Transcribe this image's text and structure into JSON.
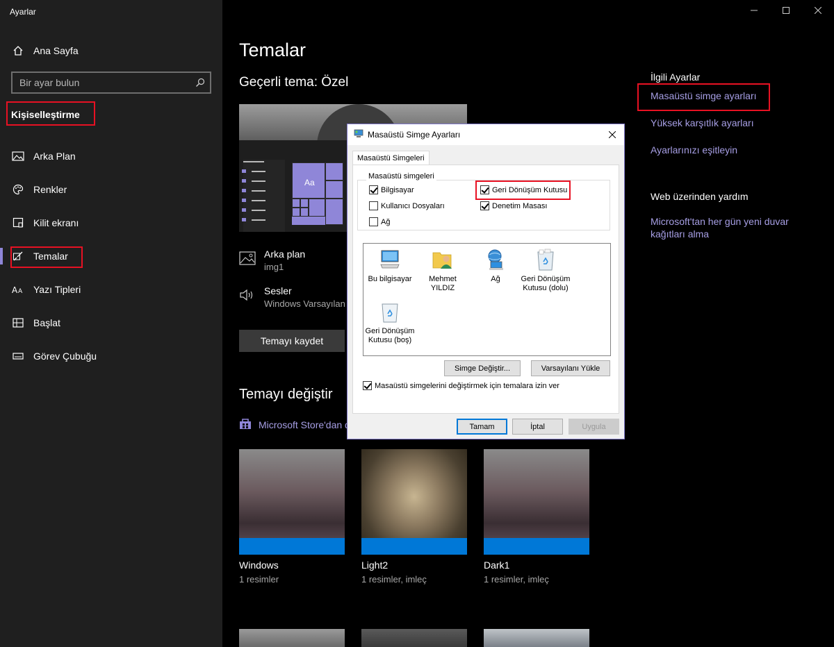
{
  "app": {
    "title": "Ayarlar"
  },
  "sidebar": {
    "home": "Ana Sayfa",
    "search_placeholder": "Bir ayar bulun",
    "section": "Kişiselleştirme",
    "items": [
      {
        "label": "Arka Plan",
        "icon": "image-icon"
      },
      {
        "label": "Renkler",
        "icon": "palette-icon"
      },
      {
        "label": "Kilit ekranı",
        "icon": "lock-screen-icon"
      },
      {
        "label": "Temalar",
        "icon": "brush-icon",
        "selected": true
      },
      {
        "label": "Yazı Tipleri",
        "icon": "font-icon"
      },
      {
        "label": "Başlat",
        "icon": "start-icon"
      },
      {
        "label": "Görev Çubuğu",
        "icon": "taskbar-icon"
      }
    ]
  },
  "colors": {
    "accent": "#8f86d8",
    "link": "#a69ee4",
    "highlight": "#e81123",
    "tile_band": "#0078d7"
  },
  "main": {
    "title": "Temalar",
    "current_theme": "Geçerli tema: Özel",
    "preview_tile_text": "Aa",
    "props": {
      "background_label": "Arka plan",
      "background_value": "img1",
      "sounds_label": "Sesler",
      "sounds_value": "Windows Varsayılan"
    },
    "save_button": "Temayı kaydet",
    "change_title": "Temayı değiştir",
    "store_link": "Microsoft Store'dan d",
    "themes": [
      {
        "name": "Windows",
        "info": "1 resimler"
      },
      {
        "name": "Light2",
        "info": "1 resimler, imleç"
      },
      {
        "name": "Dark1",
        "info": "1 resimler, imleç"
      }
    ]
  },
  "related": {
    "title": "İlgili Ayarlar",
    "links": [
      "Masaüstü simge ayarları",
      "Yüksek karşıtlık ayarları",
      "Ayarlarınızı eşitleyin"
    ],
    "web_title": "Web üzerinden yardım",
    "web_link_line1": "Microsoft'tan her gün yeni duvar",
    "web_link_line2": "kağıtları alma"
  },
  "dialog": {
    "title": "Masaüstü Simge Ayarları",
    "tab": "Masaüstü Simgeleri",
    "group_label": "Masaüstü simgeleri",
    "checkboxes": [
      {
        "label": "Bilgisayar",
        "checked": true
      },
      {
        "label": "Geri Dönüşüm Kutusu",
        "checked": true
      },
      {
        "label": "Kullanıcı Dosyaları",
        "checked": false
      },
      {
        "label": "Denetim Masası",
        "checked": true
      },
      {
        "label": "Ağ",
        "checked": false
      }
    ],
    "icons": [
      {
        "line1": "Bu bilgisayar",
        "line2": ""
      },
      {
        "line1": "Mehmet",
        "line2": "YILDIZ"
      },
      {
        "line1": "Ağ",
        "line2": ""
      },
      {
        "line1": "Geri Dönüşüm",
        "line2": "Kutusu (dolu)"
      },
      {
        "line1": "Geri Dönüşüm",
        "line2": "Kutusu (boş)"
      }
    ],
    "change_icon": "Simge Değiştir...",
    "restore_default": "Varsayılanı Yükle",
    "allow_themes": "Masaüstü simgelerini değiştirmek için temalara izin ver",
    "allow_themes_checked": true,
    "ok": "Tamam",
    "cancel": "İptal",
    "apply": "Uygula"
  }
}
